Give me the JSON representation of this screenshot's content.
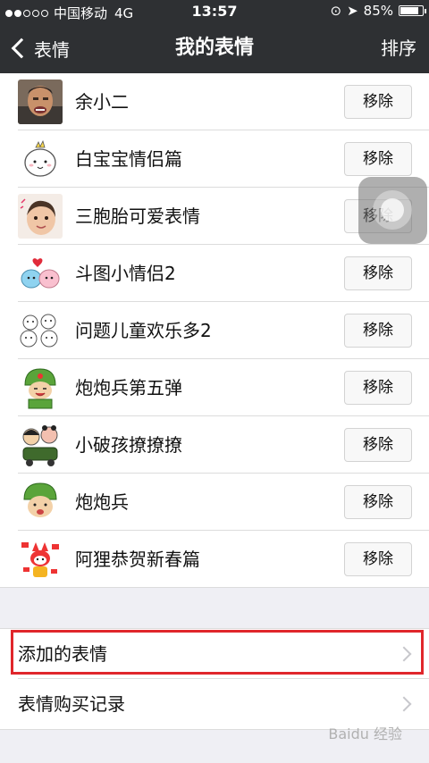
{
  "status_bar": {
    "carrier": "中国移动",
    "network": "4G",
    "time": "13:57",
    "battery": "85%",
    "battery_level": 0.85
  },
  "nav": {
    "back_label": "表情",
    "title": "我的表情",
    "sort_label": "排序"
  },
  "emoji_packs": [
    {
      "name": "余小二",
      "action": "移除"
    },
    {
      "name": "白宝宝情侣篇",
      "action": "移除"
    },
    {
      "name": "三胞胎可爱表情",
      "action": "移除"
    },
    {
      "name": "斗图小情侣2",
      "action": "移除"
    },
    {
      "name": "问题儿童欢乐多2",
      "action": "移除"
    },
    {
      "name": "炮炮兵第五弹",
      "action": "移除"
    },
    {
      "name": "小破孩撩撩撩",
      "action": "移除"
    },
    {
      "name": "炮炮兵",
      "action": "移除"
    },
    {
      "name": "阿狸恭贺新春篇",
      "action": "移除"
    }
  ],
  "menu": {
    "added_emoji": "添加的表情",
    "purchase_history": "表情购买记录"
  },
  "watermark": "Baidu 经验",
  "colors": {
    "nav_bg": "#2e3033",
    "highlight": "#e0262b",
    "page_bg": "#efeff4"
  }
}
